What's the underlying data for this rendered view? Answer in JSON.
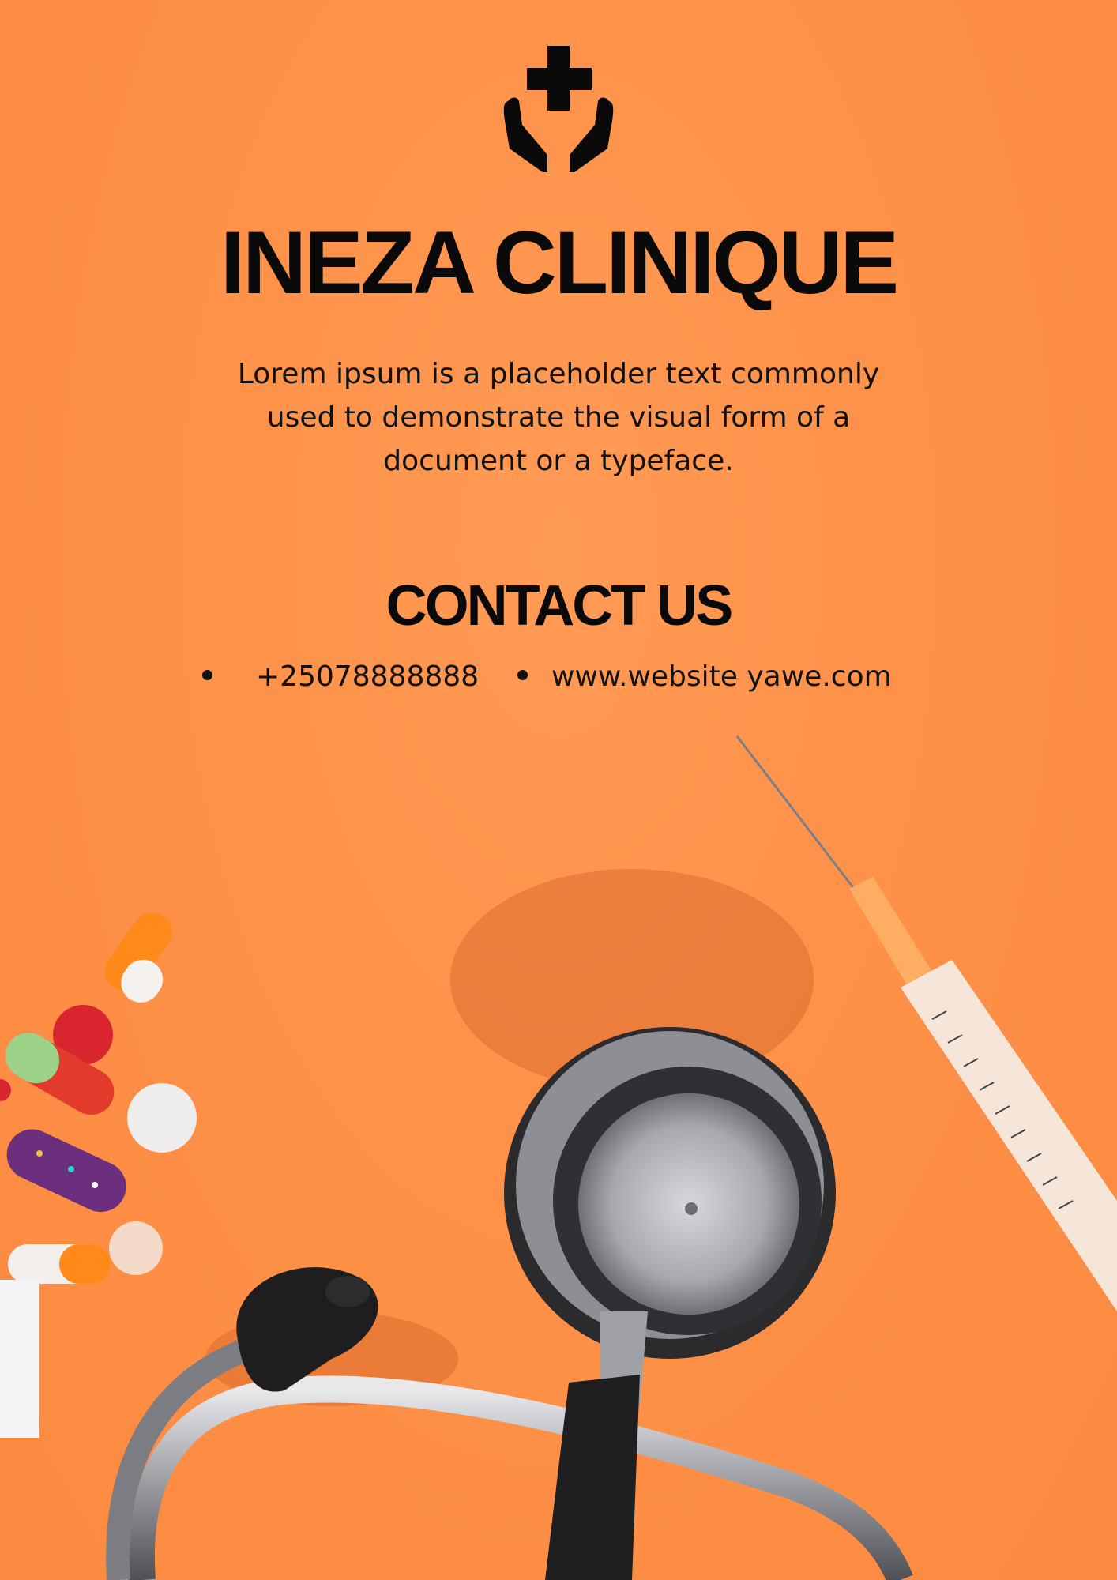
{
  "brand": {
    "logo_icon": "medical-cross-hands-icon",
    "title": "INEZA CLINIQUE",
    "description_lines": [
      "Lorem ipsum is a placeholder text commonly",
      "used to demonstrate the visual form of a",
      "document or a typeface."
    ]
  },
  "contact": {
    "heading": "CONTACT US",
    "phone": "+25078888888",
    "website": "www.website yawe.com"
  },
  "colors": {
    "background": "#ff9148",
    "text": "#0a0a0a"
  }
}
